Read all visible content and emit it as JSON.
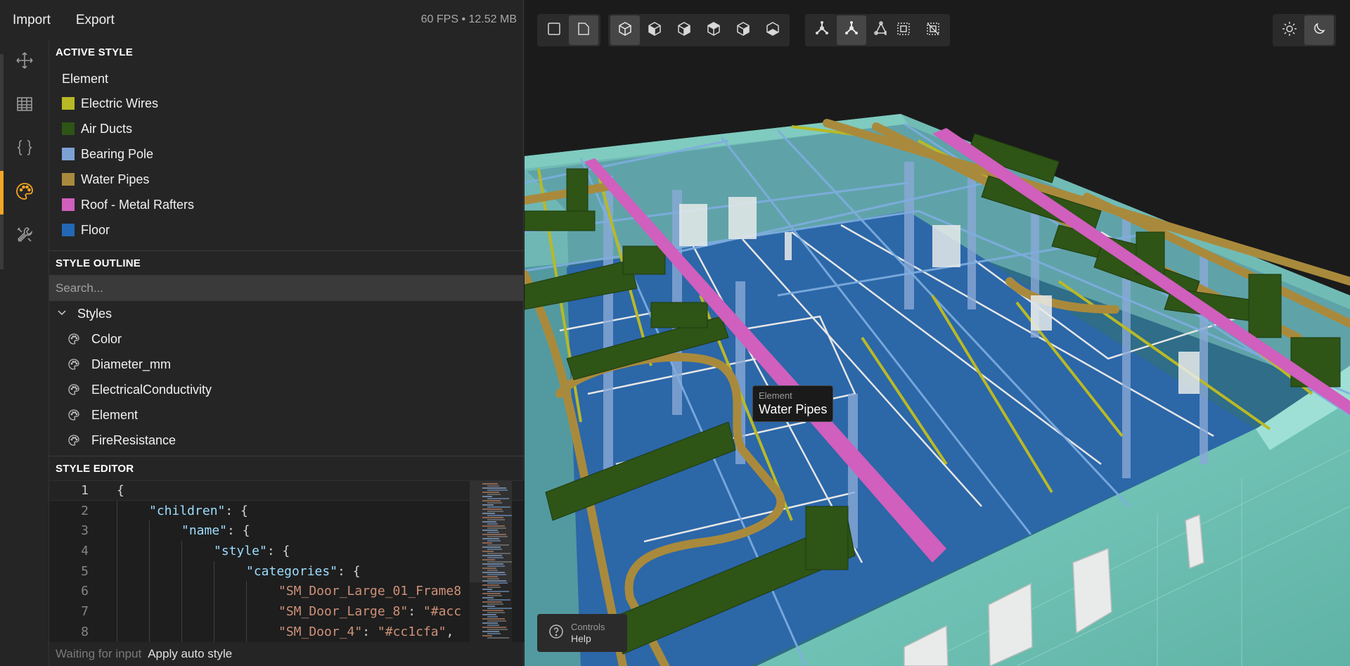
{
  "topbar": {
    "import_label": "Import",
    "export_label": "Export",
    "stats": "60 FPS • 12.52 MB"
  },
  "rail": {
    "items": [
      {
        "icon": "move-icon",
        "active": false
      },
      {
        "icon": "table-icon",
        "active": false
      },
      {
        "icon": "braces-icon",
        "active": false
      },
      {
        "icon": "palette-icon",
        "active": true
      },
      {
        "icon": "tools-icon",
        "active": false
      }
    ],
    "accent": "#f5a623"
  },
  "active_style": {
    "title": "ACTIVE STYLE",
    "header": "Element",
    "items": [
      {
        "label": "Electric Wires",
        "color": "#b9b925"
      },
      {
        "label": "Air Ducts",
        "color": "#2e5416"
      },
      {
        "label": "Bearing Pole",
        "color": "#7ea1d4"
      },
      {
        "label": "Water Pipes",
        "color": "#a98a3c"
      },
      {
        "label": "Roof - Metal Rafters",
        "color": "#d05fbd"
      },
      {
        "label": "Floor",
        "color": "#2268b4"
      }
    ]
  },
  "style_outline": {
    "title": "STYLE OUTLINE",
    "search_placeholder": "Search...",
    "root_label": "Styles",
    "children": [
      "Color",
      "Diameter_mm",
      "ElectricalConductivity",
      "Element",
      "FireResistance"
    ]
  },
  "style_editor": {
    "title": "STYLE EDITOR",
    "lines": [
      {
        "n": "1",
        "indent": 0,
        "parts": [
          {
            "t": "{",
            "c": "p"
          }
        ]
      },
      {
        "n": "2",
        "indent": 1,
        "parts": [
          {
            "t": "\"children\"",
            "c": "k"
          },
          {
            "t": ": {",
            "c": "p"
          }
        ]
      },
      {
        "n": "3",
        "indent": 2,
        "parts": [
          {
            "t": "\"name\"",
            "c": "k"
          },
          {
            "t": ": {",
            "c": "p"
          }
        ]
      },
      {
        "n": "4",
        "indent": 3,
        "parts": [
          {
            "t": "\"style\"",
            "c": "k"
          },
          {
            "t": ": {",
            "c": "p"
          }
        ]
      },
      {
        "n": "5",
        "indent": 4,
        "parts": [
          {
            "t": "\"categories\"",
            "c": "k"
          },
          {
            "t": ": {",
            "c": "p"
          }
        ]
      },
      {
        "n": "6",
        "indent": 5,
        "parts": [
          {
            "t": "\"SM_Door_Large_01_Frame8",
            "c": "s"
          }
        ]
      },
      {
        "n": "7",
        "indent": 5,
        "parts": [
          {
            "t": "\"SM_Door_Large_8\"",
            "c": "s"
          },
          {
            "t": ": ",
            "c": "p"
          },
          {
            "t": "\"#acc",
            "c": "s"
          }
        ]
      },
      {
        "n": "8",
        "indent": 5,
        "parts": [
          {
            "t": "\"SM_Door_4\"",
            "c": "s"
          },
          {
            "t": ": ",
            "c": "p"
          },
          {
            "t": "\"#cc1cfa\"",
            "c": "s"
          },
          {
            "t": ",",
            "c": "p"
          }
        ]
      }
    ]
  },
  "status": {
    "text": "Waiting for input",
    "action": "Apply auto style"
  },
  "viewport": {
    "toolbar_groups": [
      [
        {
          "icon": "square-icon",
          "on": false
        },
        {
          "icon": "perspective-square-icon",
          "on": true
        }
      ],
      [
        {
          "icon": "cube-iso-icon",
          "on": true
        },
        {
          "icon": "cube-front-icon",
          "on": false
        },
        {
          "icon": "cube-right-icon",
          "on": false
        },
        {
          "icon": "cube-left-icon",
          "on": false
        },
        {
          "icon": "cube-top-icon",
          "on": false
        },
        {
          "icon": "cube-bottom-icon",
          "on": false
        }
      ],
      [
        {
          "icon": "axis-solid-icon",
          "on": false
        },
        {
          "icon": "axis-outline-icon",
          "on": true
        },
        {
          "icon": "axis-thin-icon",
          "on": false
        }
      ],
      [
        {
          "icon": "select-box-icon",
          "on": false
        },
        {
          "icon": "deselect-box-icon",
          "on": false
        }
      ]
    ],
    "theme_buttons": [
      {
        "icon": "sun-icon",
        "on": false
      },
      {
        "icon": "moon-icon",
        "on": true
      }
    ],
    "tooltip": {
      "label": "Element",
      "value": "Water Pipes"
    },
    "help": {
      "line1": "Controls",
      "line2": "Help"
    }
  }
}
